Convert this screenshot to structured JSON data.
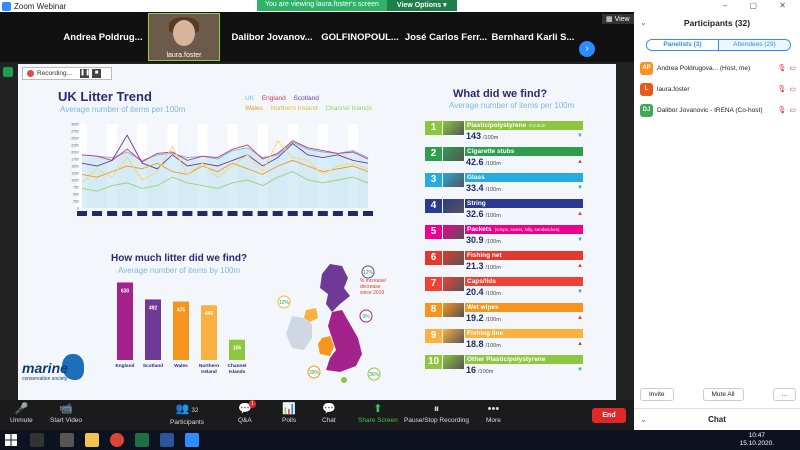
{
  "window": {
    "title": "Zoom Webinar"
  },
  "share_banner": {
    "message": "You are viewing laura.foster's screen",
    "options": "View Options"
  },
  "video_strip": {
    "names": [
      "Andrea Poldrug...",
      "Dalibor Jovanov...",
      "GOLFINOPOUL...",
      "José Carlos Ferr...",
      "Bernhard Karli S..."
    ],
    "self_name": "laura.foster",
    "view_label": "View"
  },
  "recording": {
    "label": "Recording..."
  },
  "slide": {
    "trend": {
      "title": "UK Litter Trend",
      "subtitle": "Average number of items per 100m",
      "legend": [
        "UK",
        "England",
        "Scotland",
        "Wales",
        "Northern Ireland",
        "Channel Islands"
      ]
    },
    "howmuch": {
      "title": "How much litter did we find?",
      "subtitle": "Average number of items by 100m"
    },
    "map_note": "% increase/ decrease since 2019",
    "logo": {
      "word": "marine",
      "sub": "conservation society"
    },
    "findings": {
      "title": "What did we find?",
      "subtitle": "Average number of items per 100m",
      "unit": "/100m",
      "items": [
        {
          "num": "1",
          "label": "Plastic/polystyrene",
          "note": "0-2.5cm",
          "value": "143",
          "color": "#8cc63f",
          "trend": "down"
        },
        {
          "num": "2",
          "label": "Cigarette stubs",
          "note": "",
          "value": "42.6",
          "color": "#2e9e4d",
          "trend": "up"
        },
        {
          "num": "3",
          "label": "Glass",
          "note": "",
          "value": "33.4",
          "color": "#27a9e1",
          "trend": "down"
        },
        {
          "num": "4",
          "label": "String",
          "note": "",
          "value": "32.6",
          "color": "#2b3990",
          "trend": "up"
        },
        {
          "num": "5",
          "label": "Packets",
          "note": "(crisps, sweet, lolly, sandwiches)",
          "value": "30.9",
          "color": "#ec008c",
          "trend": "down"
        },
        {
          "num": "6",
          "label": "Fishing net",
          "note": "",
          "value": "21.3",
          "color": "#e1392c",
          "trend": "up"
        },
        {
          "num": "7",
          "label": "Caps/lids",
          "note": "",
          "value": "20.4",
          "color": "#ef4136",
          "trend": "down"
        },
        {
          "num": "8",
          "label": "Wet wipes",
          "note": "",
          "value": "19.2",
          "color": "#f7941d",
          "trend": "up"
        },
        {
          "num": "9",
          "label": "Fishing line",
          "note": "",
          "value": "18.8",
          "color": "#fbb040",
          "trend": "up"
        },
        {
          "num": "10",
          "label": "Other Plastic/polystyrene",
          "note": "",
          "value": "16",
          "color": "#8dc63f",
          "trend": "down"
        }
      ]
    }
  },
  "chart_data": [
    {
      "type": "line",
      "title": "UK Litter Trend",
      "subtitle": "Average number of items per 100m",
      "yticks": [
        "3000",
        "2750",
        "2500",
        "2250",
        "2000",
        "1750",
        "1500",
        "1250",
        "1000",
        "750",
        "500",
        "250",
        "0"
      ],
      "ylim": [
        0,
        3000
      ],
      "series": [
        {
          "name": "UK",
          "color": "#5ec1e8",
          "values": [
            1900,
            1850,
            1800,
            2000,
            1700,
            1900,
            1950,
            1800,
            1850,
            1750,
            2050,
            2150,
            1800,
            1900,
            2350,
            2100,
            2000,
            1950,
            2050,
            1800
          ]
        },
        {
          "name": "England",
          "color": "#e0325c",
          "values": [
            1900,
            1850,
            1700,
            2100,
            1650,
            1950,
            2000,
            1700,
            1850,
            1800,
            2100,
            2250,
            1750,
            1950,
            2400,
            2150,
            2050,
            1950,
            2000,
            1750
          ]
        },
        {
          "name": "Scotland",
          "color": "#6f3a96",
          "values": [
            1600,
            1500,
            1700,
            2600,
            1600,
            1400,
            1900,
            1500,
            1600,
            1500,
            1700,
            1900,
            1500,
            1800,
            2300,
            1900,
            1800,
            1900,
            1700,
            1600
          ]
        },
        {
          "name": "Wales",
          "color": "#f7941d",
          "values": [
            1200,
            1100,
            1300,
            1500,
            1400,
            1600,
            1300,
            1200,
            1500,
            1300,
            1600,
            1400,
            1200,
            1500,
            1700,
            1500,
            1300,
            1400,
            1500,
            1300
          ]
        },
        {
          "name": "Northern Ireland",
          "color": "#f5d66b",
          "values": [
            900,
            1400,
            1100,
            1800,
            1000,
            1300,
            2200,
            1200,
            1600,
            1100,
            1500,
            1900,
            1300,
            2400,
            1800,
            1700,
            1200,
            1500,
            1600,
            1400
          ]
        },
        {
          "name": "Channel Islands",
          "color": "#9bd16a",
          "values": [
            700,
            600,
            800,
            900,
            700,
            800,
            1100,
            900,
            800,
            700,
            900,
            1000,
            800,
            1100,
            1300,
            1000,
            900,
            1000,
            1100,
            900
          ]
        }
      ]
    },
    {
      "type": "bar",
      "title": "How much litter did we find?",
      "subtitle": "Average number of items by 100m",
      "categories": [
        "England",
        "Scotland",
        "Wales",
        "Northern Ireland",
        "Channel Islands"
      ],
      "values": [
        630,
        492,
        475,
        445,
        165
      ],
      "colors": [
        "#a3228c",
        "#6f3a96",
        "#f7941d",
        "#fbb040",
        "#8dc63f"
      ],
      "ylim": [
        0,
        650
      ]
    }
  ],
  "map": {
    "region_values": [
      {
        "label": "12%",
        "trend": "up"
      },
      {
        "label": "12%",
        "trend": "up"
      },
      {
        "label": "9%",
        "trend": "up"
      },
      {
        "label": "39%",
        "trend": "up"
      },
      {
        "label": "36%",
        "trend": "up"
      }
    ]
  },
  "participants_panel": {
    "title": "Participants (32)",
    "tabs": [
      "Panelists (3)",
      "Attendees (29)"
    ],
    "people": [
      {
        "initials": "AP",
        "name": "Andrea Poldrugova... (Host, me)",
        "color": "#f7931e"
      },
      {
        "initials": "L",
        "name": "laura.foster",
        "color": "#e85a1a"
      },
      {
        "initials": "DJ",
        "name": "Dalibor Jovanovic - IRENA (Co-host)",
        "color": "#3caa5a"
      }
    ],
    "buttons": [
      "Invite",
      "Mute All",
      "..."
    ],
    "chat_label": "Chat"
  },
  "toolbar": {
    "buttons": [
      {
        "label": "Unmute",
        "icon": "🎤"
      },
      {
        "label": "Start Video",
        "icon": "📹"
      },
      {
        "label": "Participants",
        "icon": "👥",
        "count": "32"
      },
      {
        "label": "Q&A",
        "icon": "💬",
        "badge": "1"
      },
      {
        "label": "Polls",
        "icon": "📊"
      },
      {
        "label": "Chat",
        "icon": "💬"
      },
      {
        "label": "Share Screen",
        "icon": "⬆"
      },
      {
        "label": "Pause/Stop Recording",
        "icon": "⏸"
      },
      {
        "label": "More",
        "icon": "•••"
      }
    ],
    "end_label": "End"
  },
  "taskbar": {
    "time": "10:47",
    "date": "15.10.2020."
  }
}
